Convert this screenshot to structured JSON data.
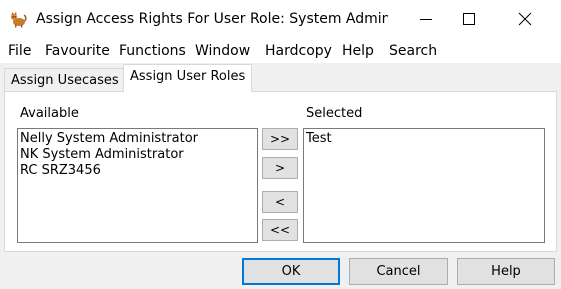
{
  "window": {
    "title": "Assign Access Rights For User Role: System Admini...",
    "icon": "cat-app-icon"
  },
  "menu": [
    "File",
    "Favourite",
    "Functions",
    "Window",
    "Hardcopy",
    "Help",
    "Search"
  ],
  "tabs": {
    "usecases": "Assign Usecases",
    "user_roles": "Assign User Roles",
    "active": "Assign User Roles"
  },
  "available": {
    "label": "Available",
    "items": [
      "Nelly System Administrator",
      "NK System Administrator",
      "RC SRZ3456"
    ]
  },
  "selected": {
    "label": "Selected",
    "items": [
      "Test"
    ]
  },
  "move_buttons": {
    "add_all": ">>",
    "add": ">",
    "remove": "<",
    "remove_all": "<<"
  },
  "dialog_buttons": {
    "ok": "OK",
    "cancel": "Cancel",
    "help": "Help"
  },
  "colors": {
    "focus_border": "#0078d7",
    "window_bg": "#f0f0f0"
  }
}
